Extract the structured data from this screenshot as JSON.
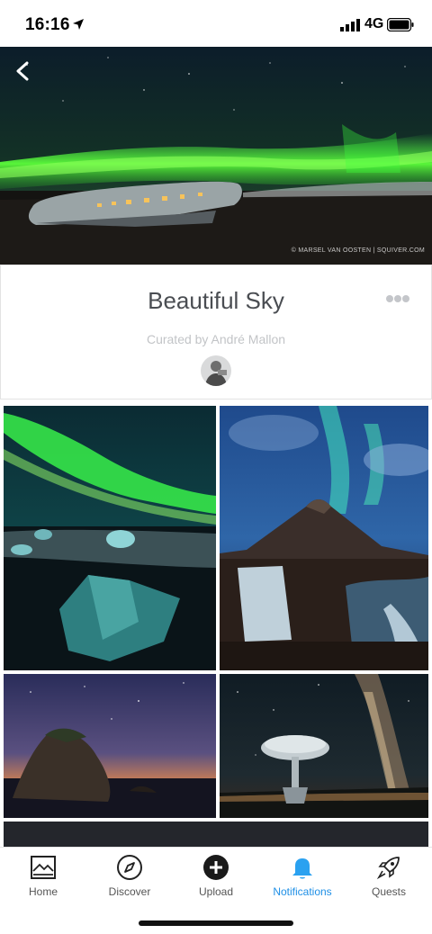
{
  "status_bar": {
    "time": "16:16",
    "network": "4G"
  },
  "hero": {
    "credit": "© MARSEL VAN OOSTEN | SQUIVER.COM"
  },
  "gallery": {
    "title": "Beautiful Sky",
    "curated_by": "Curated by André Mallon"
  },
  "tabs": [
    {
      "label": "Home",
      "icon": "home-icon"
    },
    {
      "label": "Discover",
      "icon": "compass-icon"
    },
    {
      "label": "Upload",
      "icon": "plus-circle-icon"
    },
    {
      "label": "Notifications",
      "icon": "bell-icon",
      "active": true
    },
    {
      "label": "Quests",
      "icon": "rocket-icon"
    }
  ],
  "colors": {
    "accent": "#1e8fe6",
    "title": "#4a4d52",
    "aurora": "#3cff3c"
  }
}
